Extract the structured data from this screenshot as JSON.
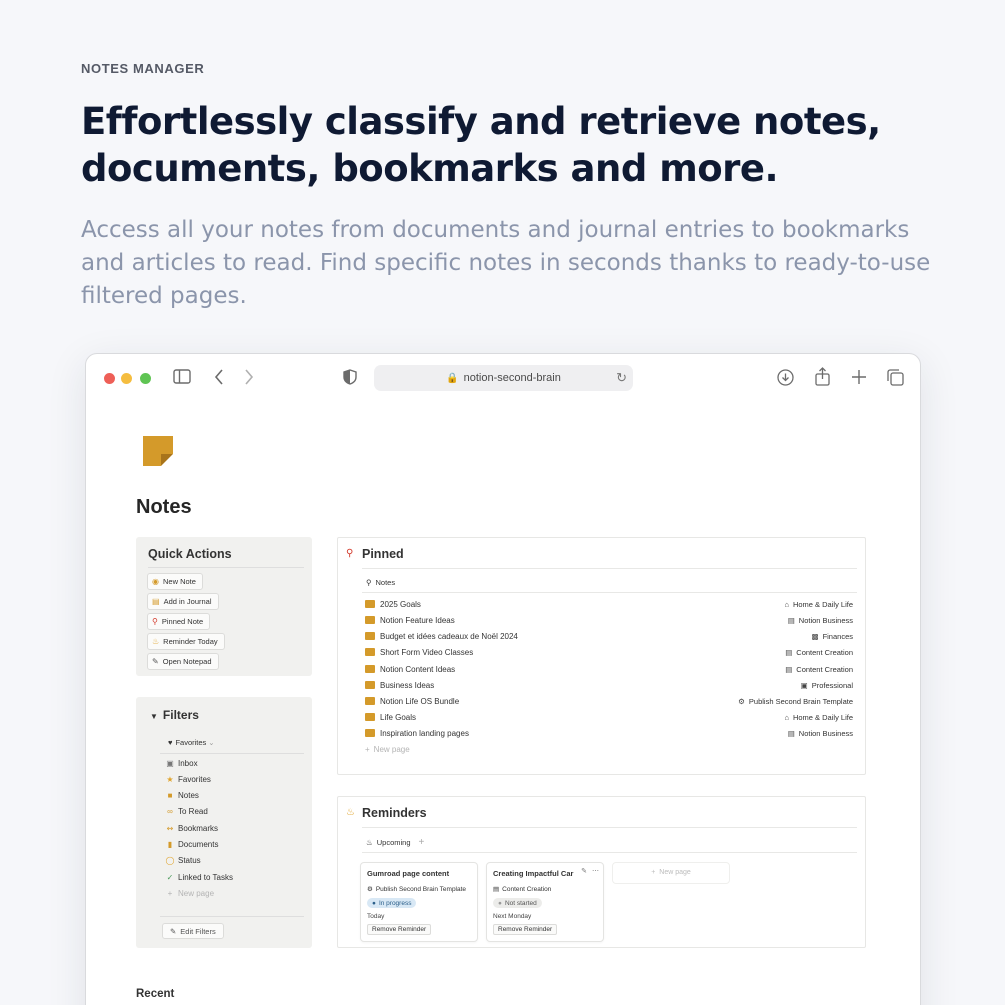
{
  "hero": {
    "eyebrow": "NOTES MANAGER",
    "headline": "Effortlessly classify and retrieve notes, documents, bookmarks and more.",
    "subtitle": "Access all your notes from documents and journal entries to bookmarks and articles to read. Find specific notes in seconds thanks to ready-to-use filtered pages."
  },
  "browser": {
    "url": "notion-second-brain",
    "traffic_light_colors": [
      "#ee5f57",
      "#f5bd3f",
      "#5fc453"
    ]
  },
  "page": {
    "title": "Notes",
    "accent": "#d49a2a"
  },
  "quick_actions": {
    "title": "Quick Actions",
    "buttons": [
      {
        "label": "New Note",
        "icon": "plus-circle-icon"
      },
      {
        "label": "Add in Journal",
        "icon": "book-icon"
      },
      {
        "label": "Pinned Note",
        "icon": "pin-icon"
      },
      {
        "label": "Reminder Today",
        "icon": "bell-icon"
      },
      {
        "label": "Open Notepad",
        "icon": "edit-icon"
      }
    ]
  },
  "filters": {
    "title": "Filters",
    "tab": "Favorites",
    "items": [
      {
        "label": "Inbox",
        "icon": "inbox-icon"
      },
      {
        "label": "Favorites",
        "icon": "star-icon"
      },
      {
        "label": "Notes",
        "icon": "note-icon"
      },
      {
        "label": "To Read",
        "icon": "glasses-icon"
      },
      {
        "label": "Bookmarks",
        "icon": "link-icon"
      },
      {
        "label": "Documents",
        "icon": "document-icon"
      },
      {
        "label": "Status",
        "icon": "status-icon"
      },
      {
        "label": "Linked to Tasks",
        "icon": "check-icon"
      }
    ],
    "new_page": "New page",
    "edit_label": "Edit Filters"
  },
  "pinned": {
    "title": "Pinned",
    "tab": "Notes",
    "rows": [
      {
        "title": "2025 Goals",
        "tag": "Home & Daily Life",
        "tag_icon": "home-icon"
      },
      {
        "title": "Notion Feature Ideas",
        "tag": "Notion Business",
        "tag_icon": "notion-icon"
      },
      {
        "title": "Budget et idées cadeaux de Noël 2024",
        "tag": "Finances",
        "tag_icon": "money-icon"
      },
      {
        "title": "Short Form Video Classes",
        "tag": "Content Creation",
        "tag_icon": "calendar-icon"
      },
      {
        "title": "Notion Content Ideas",
        "tag": "Content Creation",
        "tag_icon": "calendar-icon"
      },
      {
        "title": "Business Ideas",
        "tag": "Professional",
        "tag_icon": "briefcase-icon"
      },
      {
        "title": "Notion Life OS Bundle",
        "tag": "Publish Second Brain Template",
        "tag_icon": "gear-icon"
      },
      {
        "title": "Life Goals",
        "tag": "Home & Daily Life",
        "tag_icon": "home-icon"
      },
      {
        "title": "Inspiration landing pages",
        "tag": "Notion Business",
        "tag_icon": "notion-icon"
      }
    ],
    "new_page": "New page"
  },
  "reminders": {
    "title": "Reminders",
    "tab": "Upcoming",
    "cards": [
      {
        "title": "Gumroad page content",
        "project": "Publish Second Brain Template",
        "status": "In progress",
        "status_bg": "#d8e8f5",
        "status_fg": "#2b5f8a",
        "date": "Today",
        "button": "Remove Reminder"
      },
      {
        "title": "Creating Impactful Car",
        "project": "Content Creation",
        "status": "Not started",
        "status_bg": "#ececea",
        "status_fg": "#555555",
        "date": "Next Monday",
        "button": "Remove Reminder"
      }
    ],
    "new_page": "New page"
  },
  "recent": {
    "title": "Recent"
  }
}
